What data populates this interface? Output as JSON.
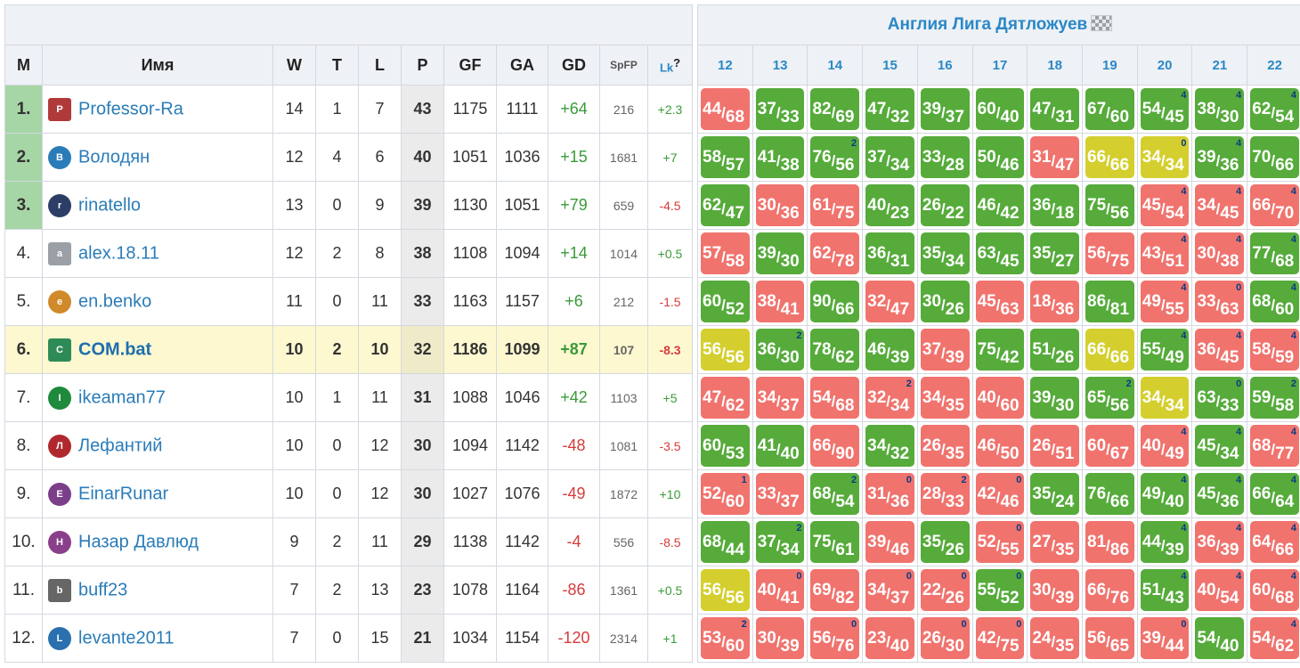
{
  "league": {
    "title": "Англия Лига Дятложуев"
  },
  "columns": {
    "m": "М",
    "name": "Имя",
    "w": "W",
    "t": "T",
    "l": "L",
    "p": "P",
    "gf": "GF",
    "ga": "GA",
    "gd": "GD",
    "spfp": "SpFP",
    "lk": "Lk",
    "lk_help": "?"
  },
  "rounds": [
    "12",
    "13",
    "14",
    "15",
    "16",
    "17",
    "18",
    "19",
    "20",
    "21",
    "22"
  ],
  "rows": [
    {
      "pos": "1.",
      "name": "Professor-Ra",
      "avatar": "P",
      "av_color": "#b03a3a",
      "av_sq": true,
      "w": "14",
      "t": "1",
      "l": "7",
      "p": "43",
      "gf": "1175",
      "ga": "1111",
      "gd": "+64",
      "spfp": "216",
      "lk": "+2.3",
      "res": [
        [
          "l",
          "44",
          "68",
          ""
        ],
        [
          "w",
          "37",
          "33",
          ""
        ],
        [
          "w",
          "82",
          "69",
          ""
        ],
        [
          "w",
          "47",
          "32",
          ""
        ],
        [
          "w",
          "39",
          "37",
          ""
        ],
        [
          "w",
          "60",
          "40",
          ""
        ],
        [
          "w",
          "47",
          "31",
          ""
        ],
        [
          "w",
          "67",
          "60",
          ""
        ],
        [
          "w",
          "54",
          "45",
          "4"
        ],
        [
          "w",
          "38",
          "30",
          "4"
        ],
        [
          "w",
          "62",
          "54",
          "4"
        ]
      ]
    },
    {
      "name": "Володян",
      "pos": "2.",
      "avatar": "В",
      "av_color": "#2a7cb8",
      "w": "12",
      "t": "4",
      "l": "6",
      "p": "40",
      "gf": "1051",
      "ga": "1036",
      "gd": "+15",
      "spfp": "1681",
      "lk": "+7",
      "res": [
        [
          "w",
          "58",
          "57",
          ""
        ],
        [
          "w",
          "41",
          "38",
          ""
        ],
        [
          "w",
          "76",
          "56",
          "2"
        ],
        [
          "w",
          "37",
          "34",
          ""
        ],
        [
          "w",
          "33",
          "28",
          ""
        ],
        [
          "w",
          "50",
          "46",
          ""
        ],
        [
          "l",
          "31",
          "47",
          ""
        ],
        [
          "d",
          "66",
          "66",
          ""
        ],
        [
          "d",
          "34",
          "34",
          "0"
        ],
        [
          "w",
          "39",
          "36",
          "4"
        ],
        [
          "w",
          "70",
          "66",
          ""
        ]
      ]
    },
    {
      "name": "rinatello",
      "pos": "3.",
      "avatar": "r",
      "av_color": "#2c3e66",
      "w": "13",
      "t": "0",
      "l": "9",
      "p": "39",
      "gf": "1130",
      "ga": "1051",
      "gd": "+79",
      "spfp": "659",
      "lk": "-4.5",
      "res": [
        [
          "w",
          "62",
          "47",
          ""
        ],
        [
          "l",
          "30",
          "36",
          ""
        ],
        [
          "l",
          "61",
          "75",
          ""
        ],
        [
          "w",
          "40",
          "23",
          ""
        ],
        [
          "w",
          "26",
          "22",
          ""
        ],
        [
          "w",
          "46",
          "42",
          ""
        ],
        [
          "w",
          "36",
          "18",
          ""
        ],
        [
          "w",
          "75",
          "56",
          ""
        ],
        [
          "l",
          "45",
          "54",
          "4"
        ],
        [
          "l",
          "34",
          "45",
          "4"
        ],
        [
          "l",
          "66",
          "70",
          "4"
        ]
      ]
    },
    {
      "name": "alex.18.11",
      "pos": "4.",
      "avatar": "a",
      "av_color": "#9aa0a6",
      "av_sq": true,
      "w": "12",
      "t": "2",
      "l": "8",
      "p": "38",
      "gf": "1108",
      "ga": "1094",
      "gd": "+14",
      "spfp": "1014",
      "lk": "+0.5",
      "res": [
        [
          "l",
          "57",
          "58",
          ""
        ],
        [
          "w",
          "39",
          "30",
          ""
        ],
        [
          "l",
          "62",
          "78",
          ""
        ],
        [
          "w",
          "36",
          "31",
          ""
        ],
        [
          "w",
          "35",
          "34",
          ""
        ],
        [
          "w",
          "63",
          "45",
          ""
        ],
        [
          "w",
          "35",
          "27",
          ""
        ],
        [
          "l",
          "56",
          "75",
          ""
        ],
        [
          "l",
          "43",
          "51",
          "4"
        ],
        [
          "l",
          "30",
          "38",
          "4"
        ],
        [
          "w",
          "77",
          "68",
          "4"
        ]
      ]
    },
    {
      "name": "en.benko",
      "pos": "5.",
      "avatar": "e",
      "av_color": "#d08a2a",
      "w": "11",
      "t": "0",
      "l": "11",
      "p": "33",
      "gf": "1163",
      "ga": "1157",
      "gd": "+6",
      "spfp": "212",
      "lk": "-1.5",
      "res": [
        [
          "w",
          "60",
          "52",
          ""
        ],
        [
          "l",
          "38",
          "41",
          ""
        ],
        [
          "w",
          "90",
          "66",
          ""
        ],
        [
          "l",
          "32",
          "47",
          ""
        ],
        [
          "w",
          "30",
          "26",
          ""
        ],
        [
          "l",
          "45",
          "63",
          ""
        ],
        [
          "l",
          "18",
          "36",
          ""
        ],
        [
          "w",
          "86",
          "81",
          ""
        ],
        [
          "l",
          "49",
          "55",
          "4"
        ],
        [
          "l",
          "33",
          "63",
          "0"
        ],
        [
          "w",
          "68",
          "60",
          "4"
        ]
      ]
    },
    {
      "name": "COM.bat",
      "pos": "6.",
      "avatar": "C",
      "av_color": "#2e8b57",
      "av_sq": true,
      "hl": true,
      "w": "10",
      "t": "2",
      "l": "10",
      "p": "32",
      "gf": "1186",
      "ga": "1099",
      "gd": "+87",
      "spfp": "107",
      "lk": "-8.3",
      "res": [
        [
          "d",
          "56",
          "56",
          ""
        ],
        [
          "w",
          "36",
          "30",
          "2"
        ],
        [
          "w",
          "78",
          "62",
          ""
        ],
        [
          "w",
          "46",
          "39",
          ""
        ],
        [
          "l",
          "37",
          "39",
          ""
        ],
        [
          "w",
          "75",
          "42",
          ""
        ],
        [
          "w",
          "51",
          "26",
          ""
        ],
        [
          "d",
          "66",
          "66",
          ""
        ],
        [
          "w",
          "55",
          "49",
          "4"
        ],
        [
          "l",
          "36",
          "45",
          "4"
        ],
        [
          "l",
          "58",
          "59",
          "4"
        ]
      ]
    },
    {
      "name": "ikeaman77",
      "pos": "7.",
      "avatar": "I",
      "av_color": "#1e8a3c",
      "w": "10",
      "t": "1",
      "l": "11",
      "p": "31",
      "gf": "1088",
      "ga": "1046",
      "gd": "+42",
      "spfp": "1103",
      "lk": "+5",
      "res": [
        [
          "l",
          "47",
          "62",
          ""
        ],
        [
          "l",
          "34",
          "37",
          ""
        ],
        [
          "l",
          "54",
          "68",
          ""
        ],
        [
          "l",
          "32",
          "34",
          "2"
        ],
        [
          "l",
          "34",
          "35",
          ""
        ],
        [
          "l",
          "40",
          "60",
          ""
        ],
        [
          "w",
          "39",
          "30",
          ""
        ],
        [
          "w",
          "65",
          "56",
          "2"
        ],
        [
          "d",
          "34",
          "34",
          ""
        ],
        [
          "w",
          "63",
          "33",
          "0"
        ],
        [
          "w",
          "59",
          "58",
          "2"
        ]
      ]
    },
    {
      "name": "Лефантий",
      "pos": "8.",
      "avatar": "Л",
      "av_color": "#b0282e",
      "w": "10",
      "t": "0",
      "l": "12",
      "p": "30",
      "gf": "1094",
      "ga": "1142",
      "gd": "-48",
      "spfp": "1081",
      "lk": "-3.5",
      "res": [
        [
          "w",
          "60",
          "53",
          ""
        ],
        [
          "w",
          "41",
          "40",
          ""
        ],
        [
          "l",
          "66",
          "90",
          ""
        ],
        [
          "w",
          "34",
          "32",
          ""
        ],
        [
          "l",
          "26",
          "35",
          ""
        ],
        [
          "l",
          "46",
          "50",
          ""
        ],
        [
          "l",
          "26",
          "51",
          ""
        ],
        [
          "l",
          "60",
          "67",
          ""
        ],
        [
          "l",
          "40",
          "49",
          "4"
        ],
        [
          "w",
          "45",
          "34",
          "4"
        ],
        [
          "l",
          "68",
          "77",
          "4"
        ]
      ]
    },
    {
      "name": "EinarRunar",
      "pos": "9.",
      "avatar": "E",
      "av_color": "#7b3f8a",
      "w": "10",
      "t": "0",
      "l": "12",
      "p": "30",
      "gf": "1027",
      "ga": "1076",
      "gd": "-49",
      "spfp": "1872",
      "lk": "+10",
      "res": [
        [
          "l",
          "52",
          "60",
          "1"
        ],
        [
          "l",
          "33",
          "37",
          ""
        ],
        [
          "w",
          "68",
          "54",
          "2"
        ],
        [
          "l",
          "31",
          "36",
          "0"
        ],
        [
          "l",
          "28",
          "33",
          "2"
        ],
        [
          "l",
          "42",
          "46",
          "0"
        ],
        [
          "w",
          "35",
          "24",
          ""
        ],
        [
          "w",
          "76",
          "66",
          ""
        ],
        [
          "w",
          "49",
          "40",
          "4"
        ],
        [
          "w",
          "45",
          "36",
          "4"
        ],
        [
          "w",
          "66",
          "64",
          "4"
        ]
      ]
    },
    {
      "name": "Назар Давлюд",
      "pos": "10.",
      "avatar": "Н",
      "av_color": "#8a3f8a",
      "w": "9",
      "t": "2",
      "l": "11",
      "p": "29",
      "gf": "1138",
      "ga": "1142",
      "gd": "-4",
      "spfp": "556",
      "lk": "-8.5",
      "res": [
        [
          "w",
          "68",
          "44",
          ""
        ],
        [
          "w",
          "37",
          "34",
          "2"
        ],
        [
          "w",
          "75",
          "61",
          ""
        ],
        [
          "l",
          "39",
          "46",
          ""
        ],
        [
          "w",
          "35",
          "26",
          ""
        ],
        [
          "l",
          "52",
          "55",
          "0"
        ],
        [
          "l",
          "27",
          "35",
          ""
        ],
        [
          "l",
          "81",
          "86",
          ""
        ],
        [
          "w",
          "44",
          "39",
          "4"
        ],
        [
          "l",
          "36",
          "39",
          "4"
        ],
        [
          "l",
          "64",
          "66",
          "4"
        ]
      ]
    },
    {
      "name": "buff23",
      "pos": "11.",
      "avatar": "b",
      "av_color": "#666666",
      "av_sq": true,
      "w": "7",
      "t": "2",
      "l": "13",
      "p": "23",
      "gf": "1078",
      "ga": "1164",
      "gd": "-86",
      "spfp": "1361",
      "lk": "+0.5",
      "res": [
        [
          "d",
          "56",
          "56",
          ""
        ],
        [
          "l",
          "40",
          "41",
          "0"
        ],
        [
          "l",
          "69",
          "82",
          ""
        ],
        [
          "l",
          "34",
          "37",
          "0"
        ],
        [
          "l",
          "22",
          "26",
          "0"
        ],
        [
          "w",
          "55",
          "52",
          "0"
        ],
        [
          "l",
          "30",
          "39",
          ""
        ],
        [
          "l",
          "66",
          "76",
          ""
        ],
        [
          "w",
          "51",
          "43",
          "4"
        ],
        [
          "l",
          "40",
          "54",
          "4"
        ],
        [
          "l",
          "60",
          "68",
          "4"
        ]
      ]
    },
    {
      "name": "levante2011",
      "pos": "12.",
      "avatar": "L",
      "av_color": "#2a6fae",
      "w": "7",
      "t": "0",
      "l": "15",
      "p": "21",
      "gf": "1034",
      "ga": "1154",
      "gd": "-120",
      "spfp": "2314",
      "lk": "+1",
      "res": [
        [
          "l",
          "53",
          "60",
          "2"
        ],
        [
          "l",
          "30",
          "39",
          ""
        ],
        [
          "l",
          "56",
          "76",
          "0"
        ],
        [
          "l",
          "23",
          "40",
          ""
        ],
        [
          "l",
          "26",
          "30",
          "0"
        ],
        [
          "l",
          "42",
          "75",
          "0"
        ],
        [
          "l",
          "24",
          "35",
          ""
        ],
        [
          "l",
          "56",
          "65",
          ""
        ],
        [
          "l",
          "39",
          "44",
          "0"
        ],
        [
          "w",
          "54",
          "40",
          ""
        ],
        [
          "l",
          "54",
          "62",
          "4"
        ]
      ]
    }
  ]
}
